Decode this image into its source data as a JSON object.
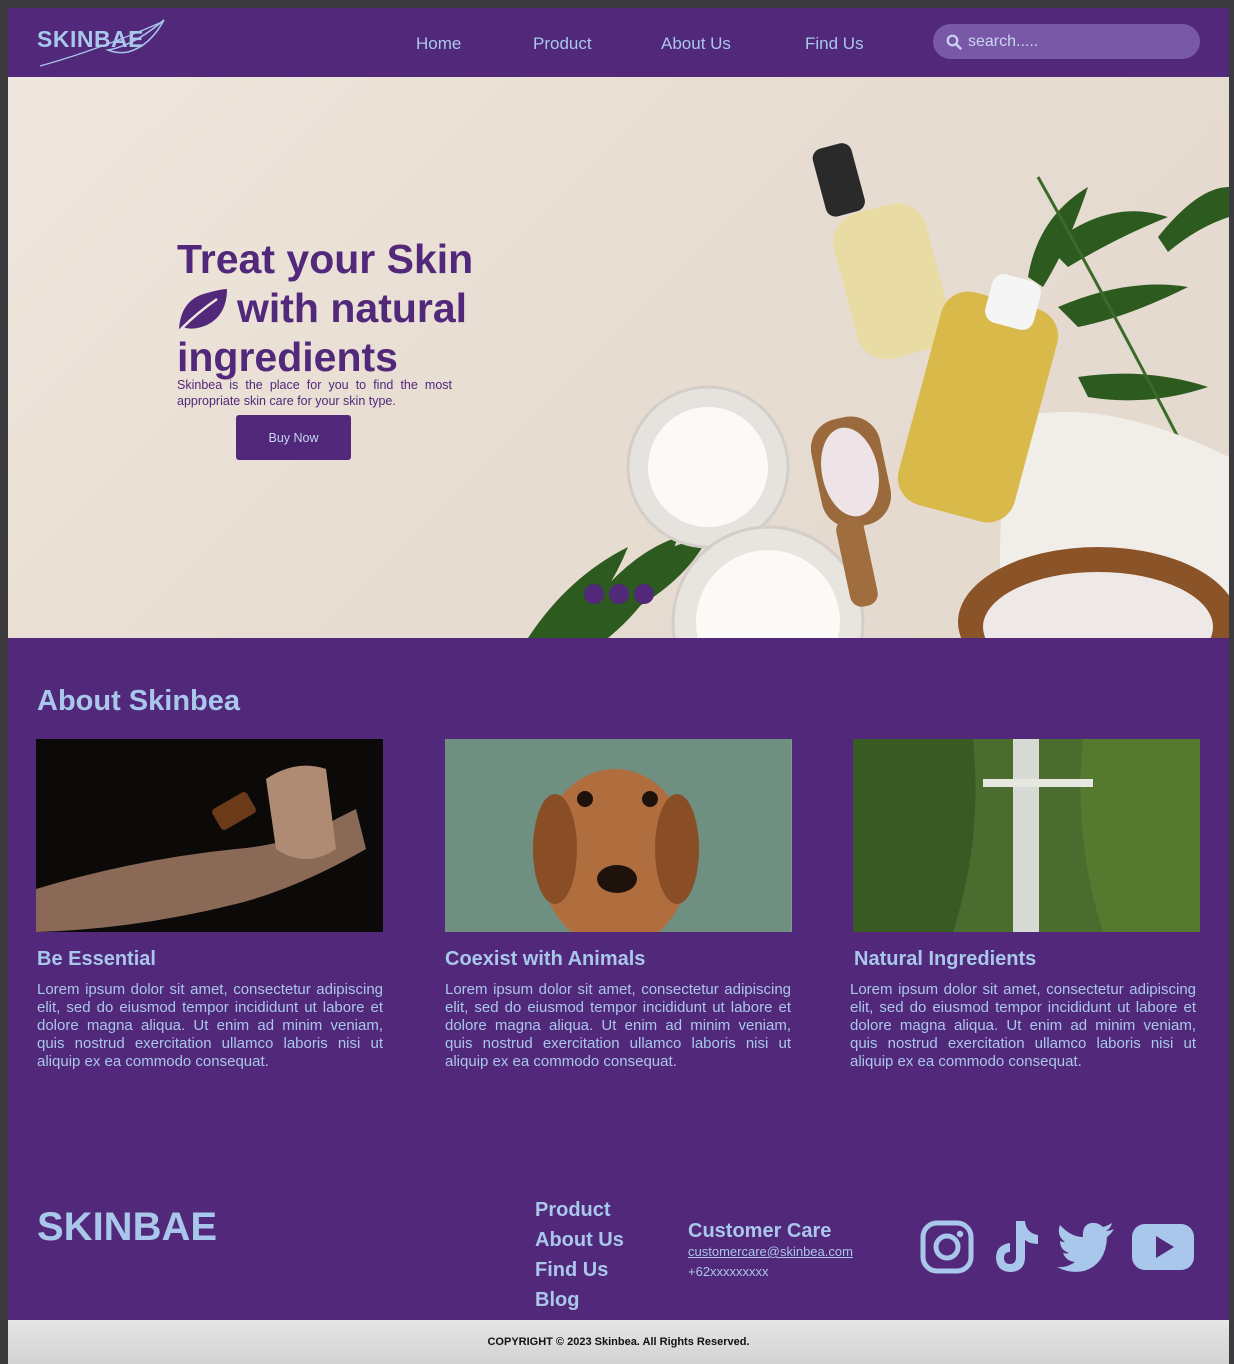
{
  "brand": {
    "logo": "SKINBAE",
    "footer_logo": "SKINBAE"
  },
  "nav": {
    "items": [
      {
        "label": "Home"
      },
      {
        "label": "Product"
      },
      {
        "label": "About Us"
      },
      {
        "label": "Find Us"
      }
    ],
    "search_placeholder": "search....."
  },
  "hero": {
    "title_line1": "Treat your Skin",
    "title_line2": "with natural",
    "title_line3": "ingredients",
    "subtitle": "Skinbea is the place for you to find the most appropriate skin care for your skin type.",
    "cta": "Buy Now",
    "slides": 3
  },
  "about": {
    "title": "About Skinbea",
    "cards": [
      {
        "title": "Be Essential",
        "text": "Lorem ipsum dolor sit amet, consectetur adipiscing elit, sed do eiusmod tempor incididunt ut labore et dolore magna aliqua. Ut enim ad minim veniam, quis nostrud exercitation ullamco laboris nisi ut aliquip ex ea commodo consequat."
      },
      {
        "title": "Coexist with Animals",
        "text": "Lorem ipsum dolor sit amet, consectetur adipiscing elit, sed do eiusmod tempor incididunt ut labore et dolore magna aliqua. Ut enim ad minim veniam, quis nostrud exercitation ullamco laboris nisi ut aliquip ex ea commodo consequat."
      },
      {
        "title": "Natural Ingredients",
        "text": "Lorem ipsum dolor sit amet, consectetur adipiscing elit, sed do eiusmod tempor incididunt ut labore et dolore magna aliqua. Ut enim ad minim veniam, quis nostrud exercitation ullamco laboris nisi ut aliquip ex ea commodo consequat."
      }
    ]
  },
  "footer": {
    "links": [
      {
        "label": "Product"
      },
      {
        "label": "About Us"
      },
      {
        "label": "Find Us"
      },
      {
        "label": "Blog"
      }
    ],
    "care_title": "Customer Care",
    "care_email": "customercare@skinbea.com",
    "care_phone": "+62xxxxxxxxx",
    "social": [
      "instagram-icon",
      "tiktok-icon",
      "twitter-icon",
      "youtube-icon"
    ],
    "copyright": "COPYRIGHT © 2023 Skinbea. All Rights Reserved."
  },
  "colors": {
    "primary": "#51287a",
    "accent": "#a9c7ea",
    "footer_bar": "#dcdcdc"
  }
}
